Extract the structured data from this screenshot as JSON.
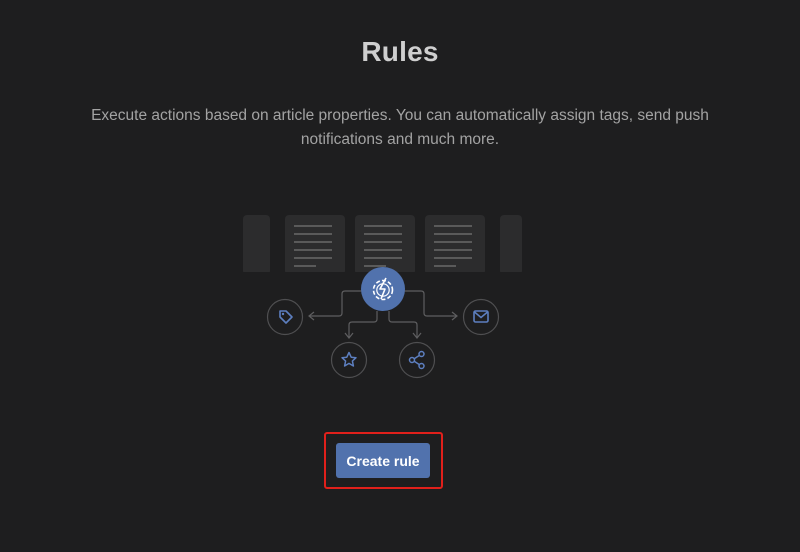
{
  "header": {
    "title": "Rules"
  },
  "description": "Execute actions based on article properties. You can automatically assign tags, send push notifications and much more.",
  "illustration": {
    "center_icon": "rule-gear-lightning-icon",
    "action_icons": [
      "tag-icon",
      "star-icon",
      "share-icon",
      "mail-icon"
    ],
    "accent_color": "#5172ad"
  },
  "actions": {
    "create_rule_label": "Create rule"
  }
}
